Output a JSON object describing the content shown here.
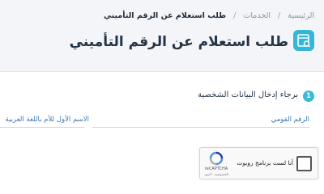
{
  "breadcrumb": {
    "home": "الرئيسية",
    "services": "الخدمات",
    "current": "طلب استعلام عن الرقم التأميني"
  },
  "page": {
    "title": "طلب استعلام عن الرقم التأميني",
    "icon": "document-search-icon"
  },
  "step": {
    "number": "1",
    "label": "برجاء إدخال البيانات الشخصية"
  },
  "form": {
    "national_id_label": "الرقم القومي",
    "mother_first_name_label": "الاسم الأول للأم باللغة العربية"
  },
  "captcha": {
    "label": "أنا لست برنامج روبوت",
    "brand": "reCAPTCHA",
    "links": "الخصوصية - البنود"
  },
  "colors": {
    "accent": "#3bb9da",
    "link": "#3a78b8",
    "header_bg": "#f3f5f8"
  }
}
